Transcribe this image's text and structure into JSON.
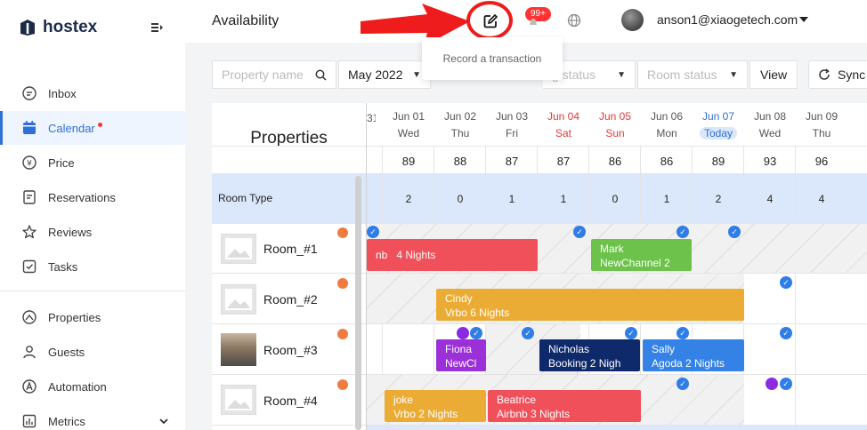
{
  "app": {
    "name": "hostex"
  },
  "sidebar": {
    "items": [
      {
        "label": "Inbox",
        "icon": "chat-bubble-icon"
      },
      {
        "label": "Calendar",
        "icon": "calendar-icon"
      },
      {
        "label": "Price",
        "icon": "yen-icon"
      },
      {
        "label": "Reservations",
        "icon": "document-icon"
      },
      {
        "label": "Reviews",
        "icon": "star-icon"
      },
      {
        "label": "Tasks",
        "icon": "check-square-icon"
      },
      {
        "label": "Properties",
        "icon": "house-icon"
      },
      {
        "label": "Guests",
        "icon": "person-icon"
      },
      {
        "label": "Automation",
        "icon": "automation-icon"
      },
      {
        "label": "Metrics",
        "icon": "bar-chart-icon"
      }
    ]
  },
  "header": {
    "title": "Availability",
    "badge": "99+",
    "user": "anson1@xiaogetech.com",
    "tooltip": "Record a transaction"
  },
  "toolbar": {
    "property_placeholder": "Property name",
    "month": "May 2022",
    "booking_status": "g status",
    "room_status": "Room status",
    "view": "View",
    "sync": "Sync"
  },
  "calendar": {
    "properties_header": "Properties",
    "room_type_label": "Room Type",
    "partial_first_day": "31",
    "days": [
      {
        "date": "Jun 01",
        "dow": "Wed",
        "avail": "89",
        "rt": "2",
        "color": "#555"
      },
      {
        "date": "Jun 02",
        "dow": "Thu",
        "avail": "88",
        "rt": "0",
        "color": "#555"
      },
      {
        "date": "Jun 03",
        "dow": "Fri",
        "avail": "87",
        "rt": "1",
        "color": "#555"
      },
      {
        "date": "Jun 04",
        "dow": "Sat",
        "avail": "87",
        "rt": "1",
        "color": "#e23b3b"
      },
      {
        "date": "Jun 05",
        "dow": "Sun",
        "avail": "86",
        "rt": "0",
        "color": "#e23b3b"
      },
      {
        "date": "Jun 06",
        "dow": "Mon",
        "avail": "86",
        "rt": "1",
        "color": "#555"
      },
      {
        "date": "Jun 07",
        "dow": "Today",
        "avail": "89",
        "rt": "2",
        "color": "#2e6fd8"
      },
      {
        "date": "Jun 08",
        "dow": "Wed",
        "avail": "93",
        "rt": "4",
        "color": "#555"
      },
      {
        "date": "Jun 09",
        "dow": "Thu",
        "avail": "96",
        "rt": "4",
        "color": "#555"
      }
    ],
    "rooms": [
      "Room_#1",
      "Room_#2",
      "Room_#3",
      "Room_#4"
    ],
    "bookings": [
      {
        "line1": "nb",
        "line2": "4 Nights",
        "color": "#f0505a"
      },
      {
        "line1": "Mark",
        "line2": "NewChannel   2",
        "color": "#6cc24a"
      },
      {
        "line1": "Cindy",
        "line2": "Vrbo    6 Nights",
        "color": "#ebac35"
      },
      {
        "line1": "Fiona",
        "line2": "NewCl",
        "color": "#9b2fd8"
      },
      {
        "line1": "Nicholas",
        "line2": "Booking    2 Nigh",
        "color": "#0f2a6b"
      },
      {
        "line1": "Sally",
        "line2": "Agoda    2 Nights",
        "color": "#3482e6"
      },
      {
        "line1": "joke",
        "line2": "Vrbo    2 Nights",
        "color": "#ebac35"
      },
      {
        "line1": "Beatrice",
        "line2": "Airbnb    3 Nights",
        "color": "#f0505a"
      }
    ]
  }
}
